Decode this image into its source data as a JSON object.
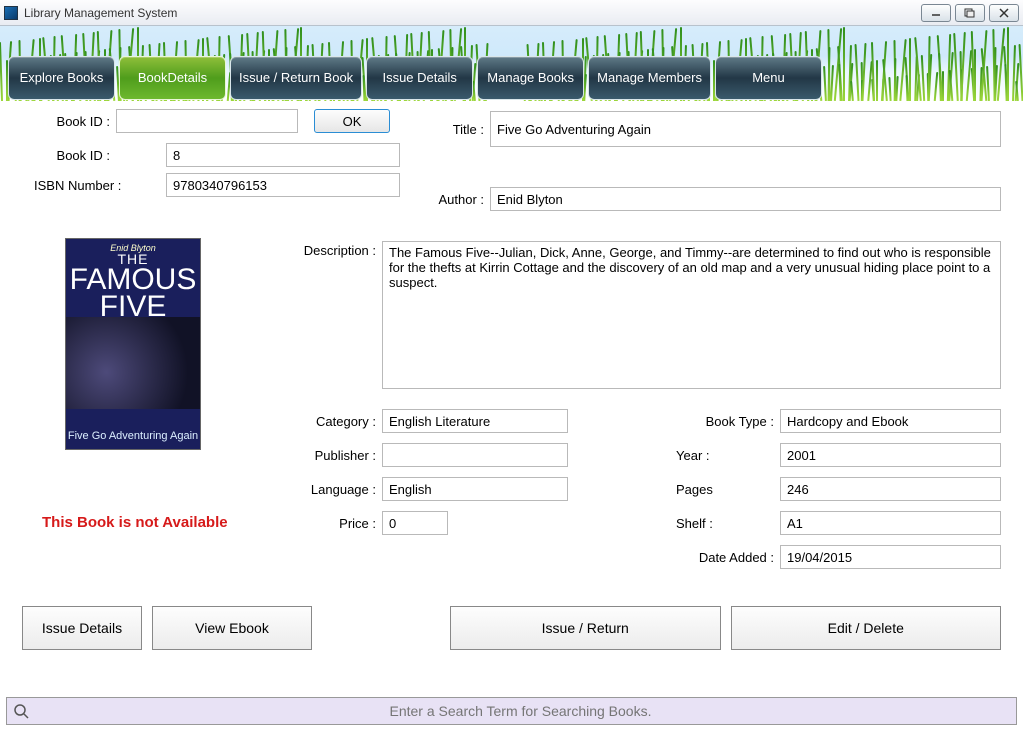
{
  "window": {
    "title": "Library Management System"
  },
  "tabs": [
    {
      "label": "Explore Books"
    },
    {
      "label": "BookDetails"
    },
    {
      "label": "Issue / Return Book"
    },
    {
      "label": "Issue Details"
    },
    {
      "label": "Manage Books"
    },
    {
      "label": "Manage Members"
    },
    {
      "label": "Menu"
    }
  ],
  "fields": {
    "book_id_search_label": "Book ID :",
    "book_id_search_value": "",
    "ok": "OK",
    "book_id_label": "Book ID :",
    "book_id_value": "8",
    "isbn_label": "ISBN Number :",
    "isbn_value": "9780340796153",
    "title_label": "Title :",
    "title_value": "Five Go Adventuring Again",
    "author_label": "Author :",
    "author_value": "Enid Blyton",
    "description_label": "Description :",
    "description_value": "The Famous Five--Julian, Dick, Anne, George, and Timmy--are determined to find out who is responsible for the thefts at Kirrin Cottage and the discovery of an old map and a very unusual hiding place point to a suspect.",
    "category_label": "Category :",
    "category_value": "English Literature",
    "publisher_label": "Publisher :",
    "publisher_value": "",
    "language_label": "Language :",
    "language_value": "English",
    "price_label": "Price :",
    "price_value": "0",
    "booktype_label": "Book Type :",
    "booktype_value": "Hardcopy and Ebook",
    "year_label": "Year :",
    "year_value": "2001",
    "pages_label": "Pages",
    "pages_value": "246",
    "shelf_label": "Shelf :",
    "shelf_value": "A1",
    "dateadded_label": "Date Added :",
    "dateadded_value": "19/04/2015"
  },
  "cover": {
    "author": "Enid Blyton",
    "line1": "THE",
    "line2": "FAMOUS",
    "line3": "FIVE",
    "subtitle": "Five Go Adventuring Again"
  },
  "availability_message": "This Book is not Available",
  "buttons": {
    "issue_details": "Issue Details",
    "view_ebook": "View Ebook",
    "issue_return": "Issue / Return",
    "edit_delete": "Edit / Delete"
  },
  "search_placeholder": "Enter a Search Term for Searching Books."
}
